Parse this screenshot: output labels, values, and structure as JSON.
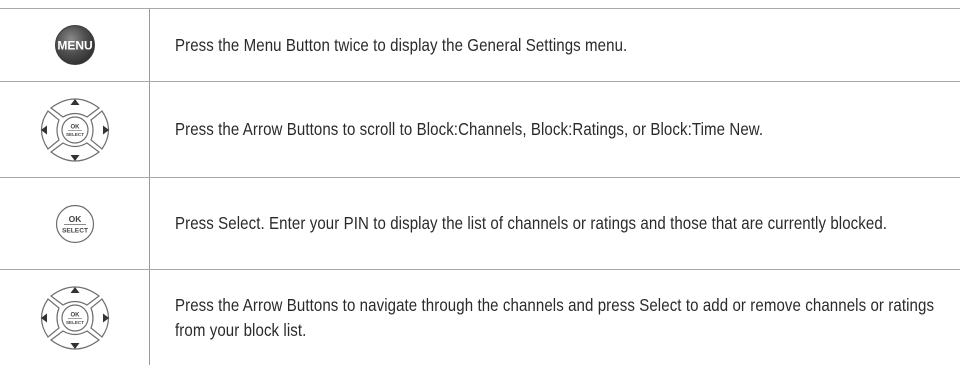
{
  "steps": [
    {
      "icon": "menu-button-icon",
      "button_label": "MENU",
      "text": "Press the Menu Button twice to display the General Settings menu."
    },
    {
      "icon": "arrow-pad-icon",
      "center_label_top": "OK",
      "center_label_bottom": "SELECT",
      "text": "Press the Arrow Buttons to scroll to Block:Channels, Block:Ratings, or Block:Time New."
    },
    {
      "icon": "ok-select-button-icon",
      "label_top": "OK",
      "label_bottom": "SELECT",
      "text": "Press Select. Enter your PIN to display the list of channels or ratings and those that are currently blocked."
    },
    {
      "icon": "arrow-pad-icon",
      "center_label_top": "OK",
      "center_label_bottom": "SELECT",
      "text": "Press the Arrow Buttons to navigate through the channels and press Select to add or remove channels or ratings from your block list."
    }
  ],
  "colors": {
    "border": "#a9a9a9",
    "text": "#2a2a2a",
    "menu_button": "#4a4a4a",
    "icon_stroke": "#6e6e6e"
  }
}
